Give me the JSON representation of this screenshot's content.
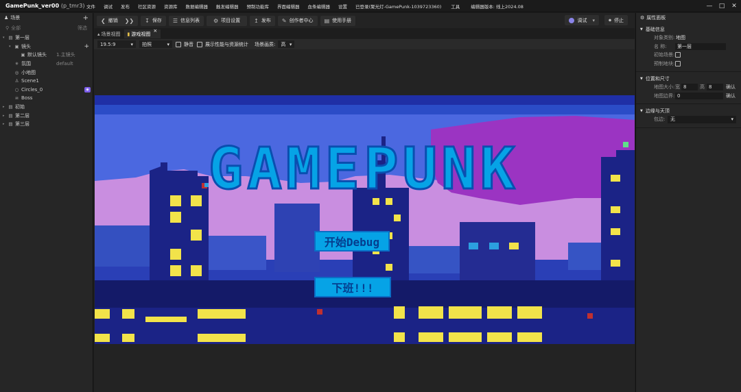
{
  "window": {
    "title": "GamePunk_ver00",
    "title_sub": "(p_tmr3)",
    "menus": [
      "文件",
      "调试",
      "发布",
      "社区资源",
      "资源库",
      "数据编辑器",
      "触发编辑器",
      "预制功能库",
      "界面编辑器",
      "血条编辑器",
      "设置"
    ],
    "login_status": "已登录(聚光灯-GamePunk-1039723360)",
    "tools_label": "工具",
    "version": "编辑器版本: 线上2024.08"
  },
  "scene_panel": {
    "title": "场景",
    "search_placeholder": "全部",
    "filter_label": "筛选",
    "tree": [
      {
        "label": "第一层",
        "icon": "folder-icon",
        "depth": 0,
        "expanded": true
      },
      {
        "label": "镜头",
        "icon": "camera-icon",
        "depth": 1,
        "expanded": true,
        "add": true
      },
      {
        "label": "默认镜头",
        "icon": "camera-icon",
        "depth": 2,
        "extra": "1.主镜头"
      },
      {
        "label": "氛围",
        "icon": "sparkle-icon",
        "depth": 1,
        "extra": "default"
      },
      {
        "label": "小地图",
        "icon": "map-icon",
        "depth": 1
      },
      {
        "label": "Scene1",
        "icon": "scene-icon",
        "depth": 1
      },
      {
        "label": "Circles_0",
        "icon": "circle-icon",
        "depth": 1,
        "badge": true
      },
      {
        "label": "Boss",
        "icon": "boss-icon",
        "depth": 1
      },
      {
        "label": "初始",
        "icon": "folder-icon",
        "depth": 0
      },
      {
        "label": "第二层",
        "icon": "folder-icon",
        "depth": 0
      },
      {
        "label": "第三层",
        "icon": "folder-icon",
        "depth": 0
      }
    ]
  },
  "toolbar": {
    "undo_label": "撤销",
    "save_label": "保存",
    "info_list_label": "信息列表",
    "project_settings_label": "项目设置",
    "publish_label": "发布",
    "creator_center_label": "创作者中心",
    "manual_label": "使用手册",
    "debug_label": "调试",
    "stop_label": "停止"
  },
  "tabs": [
    {
      "label": "场景视图",
      "active": false
    },
    {
      "label": "游戏视图",
      "active": true
    }
  ],
  "view_options": {
    "aspect": "19.5:9",
    "capture": "拍照",
    "mute_label": "静音",
    "stats_label": "展示性能与资源统计",
    "quality_label": "场景画质:",
    "quality_value": "高"
  },
  "game": {
    "logo_text": "GAMEPUNK",
    "start_button": "开始Debug",
    "quit_button": "下班!!!"
  },
  "properties": {
    "title": "属性面板",
    "basic": {
      "title": "基础信息",
      "object_type_label": "对象类别:",
      "object_type_value": "地图",
      "name_label": "名  称:",
      "name_value": "第一层",
      "initial_scene_label": "初始场景:",
      "prefab_label": "预制地块:"
    },
    "position": {
      "title": "位置和尺寸",
      "map_size_label": "地图大小:",
      "width_label": "宽",
      "width_value": "8",
      "height_label": "高",
      "height_value": "8",
      "confirm_label": "确认",
      "margin_label": "地图边界:",
      "margin_value": "0",
      "confirm2_label": "确认"
    },
    "edge": {
      "title": "边缘与天顶",
      "wrap_label": "包边:",
      "wrap_value": "无"
    }
  }
}
